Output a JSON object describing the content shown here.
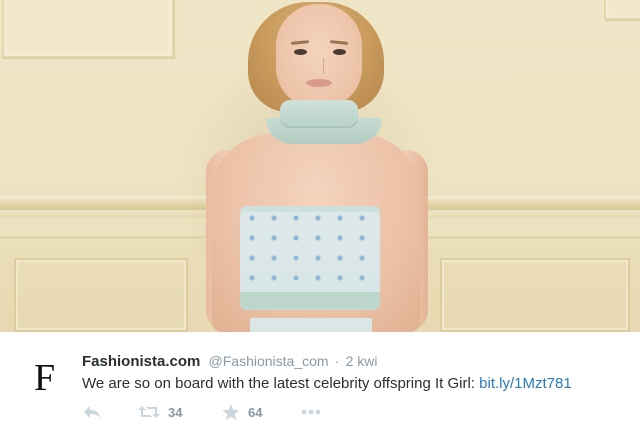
{
  "tweet": {
    "author_name": "Fashionista.com",
    "author_handle": "@Fashionista_com",
    "separator": "·",
    "time": "2 kwi",
    "text": "We are so on board with the latest celebrity offspring It Girl: ",
    "link": "bit.ly/1Mzt781",
    "logo_letter": "F",
    "actions": {
      "reply": {
        "icon": "reply-icon"
      },
      "retweet": {
        "icon": "retweet-icon",
        "count": "34"
      },
      "favorite": {
        "icon": "star-icon",
        "count": "64"
      },
      "more": {
        "icon": "more-icon"
      }
    }
  },
  "colors": {
    "link": "#2b7bb9",
    "muted": "#8899a6",
    "text": "#292f33"
  }
}
